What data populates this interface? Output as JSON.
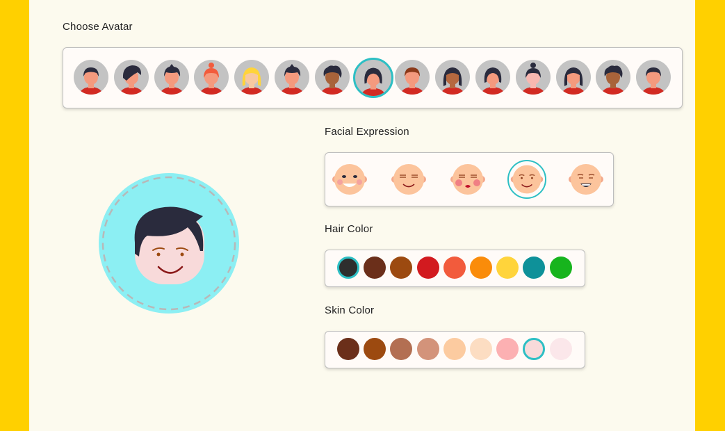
{
  "labels": {
    "choose_avatar": "Choose Avatar",
    "facial_expression": "Facial Expression",
    "hair_color": "Hair Color",
    "skin_color": "Skin Color"
  },
  "avatars": [
    {
      "name": "avatar-1",
      "hair": "#2A2B3D",
      "skin": "#F49A7E",
      "style": "short"
    },
    {
      "name": "avatar-2",
      "hair": "#2A2B3D",
      "skin": "#F49A7E",
      "style": "swoop"
    },
    {
      "name": "avatar-3",
      "hair": "#2A2B3D",
      "skin": "#F49A7E",
      "style": "spiky"
    },
    {
      "name": "avatar-4",
      "hair": "#F25B3C",
      "skin": "#F49A7E",
      "style": "bun"
    },
    {
      "name": "avatar-5",
      "hair": "#FFD43B",
      "skin": "#F8C8A0",
      "style": "long"
    },
    {
      "name": "avatar-6",
      "hair": "#2A2B3D",
      "skin": "#F49A7E",
      "style": "spiky"
    },
    {
      "name": "avatar-7",
      "hair": "#2A2B3D",
      "skin": "#A8633A",
      "style": "curly"
    },
    {
      "name": "avatar-8",
      "hair": "#2A2B3D",
      "skin": "#F49A7E",
      "style": "bob",
      "selected": true
    },
    {
      "name": "avatar-9",
      "hair": "#8B3A1A",
      "skin": "#F49A7E",
      "style": "short"
    },
    {
      "name": "avatar-10",
      "hair": "#2A2B3D",
      "skin": "#B5683F",
      "style": "long"
    },
    {
      "name": "avatar-11",
      "hair": "#2A2B3D",
      "skin": "#F49A7E",
      "style": "bob"
    },
    {
      "name": "avatar-12",
      "hair": "#2A2B3D",
      "skin": "#F8B7B0",
      "style": "bun"
    },
    {
      "name": "avatar-13",
      "hair": "#2A2B3D",
      "skin": "#F49A7E",
      "style": "long"
    },
    {
      "name": "avatar-14",
      "hair": "#2A2B3D",
      "skin": "#A8633A",
      "style": "curly"
    },
    {
      "name": "avatar-15",
      "hair": "#2A2B3D",
      "skin": "#F49A7E",
      "style": "short"
    }
  ],
  "expressions": [
    {
      "name": "expression-grin"
    },
    {
      "name": "expression-calm-smile"
    },
    {
      "name": "expression-blush-kiss"
    },
    {
      "name": "expression-gentle-smile",
      "selected": true
    },
    {
      "name": "expression-wink-laugh"
    }
  ],
  "hair_colors": [
    "#2E2E2E",
    "#6B2F1A",
    "#9C4A10",
    "#D21A1F",
    "#F25B3C",
    "#FA8C0A",
    "#FFD43B",
    "#0E9199",
    "#17B41D"
  ],
  "hair_selected_index": 0,
  "skin_colors": [
    "#6B2F1A",
    "#9C4A10",
    "#B36F52",
    "#D3937A",
    "#FCCBA0",
    "#FCDDC2",
    "#FCB0B2",
    "#F8DADA",
    "#FBE7EA"
  ],
  "skin_selected_index": 7,
  "preview": {
    "hair": "#2A2B3D",
    "skin": "#F8DADA",
    "ring": "#8CEFF3"
  }
}
